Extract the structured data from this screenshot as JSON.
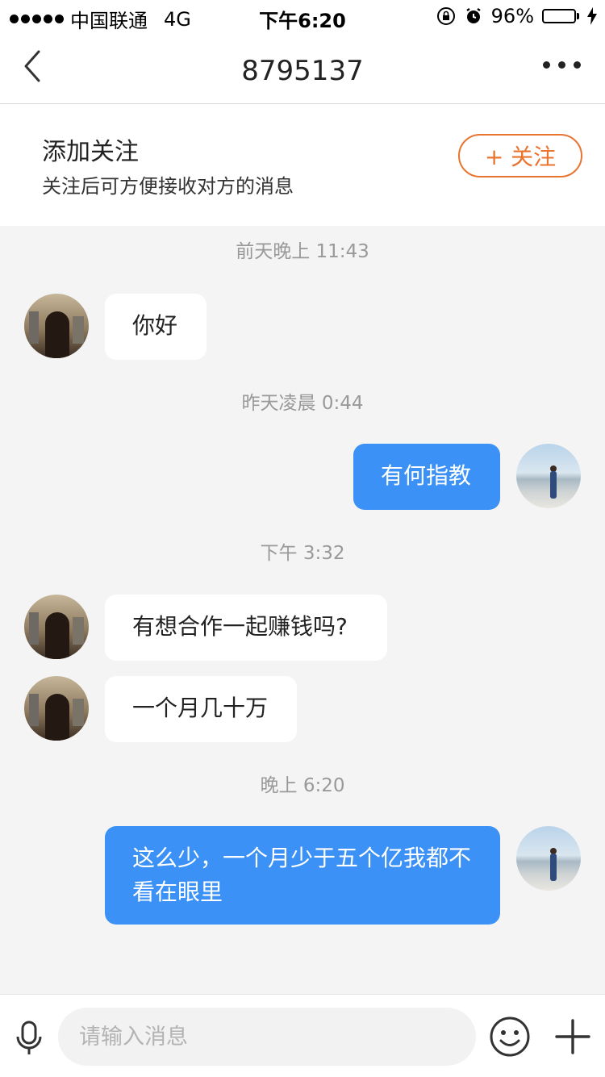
{
  "status_bar": {
    "carrier": "中国联通",
    "network": "4G",
    "time": "下午6:20",
    "battery_percent": "96%",
    "battery_level": 0.96
  },
  "nav": {
    "title": "8795137",
    "back_icon": "chevron-left-icon",
    "more_icon": "more-dots-icon"
  },
  "follow_banner": {
    "title": "添加关注",
    "subtitle": "关注后可方便接收对方的消息",
    "button_label": "+ 关注",
    "accent_color": "#e8742f"
  },
  "chat": {
    "timestamps": [
      "前天晚上 11:43",
      "昨天凌晨 0:44",
      "下午 3:32",
      "晚上 6:20"
    ],
    "messages": [
      {
        "sender": "other",
        "text": "你好"
      },
      {
        "sender": "me",
        "text": "有何指教"
      },
      {
        "sender": "other",
        "text": "有想合作一起赚钱吗?"
      },
      {
        "sender": "other",
        "text": "一个月几十万"
      },
      {
        "sender": "me",
        "text": "这么少，一个月少于五个亿我都不看在眼里"
      }
    ],
    "outgoing_bubble_color": "#3b91f5",
    "incoming_bubble_color": "#ffffff"
  },
  "input_bar": {
    "placeholder": "请输入消息",
    "mic_icon": "microphone-icon",
    "emoji_icon": "smiley-icon",
    "plus_icon": "plus-icon"
  }
}
